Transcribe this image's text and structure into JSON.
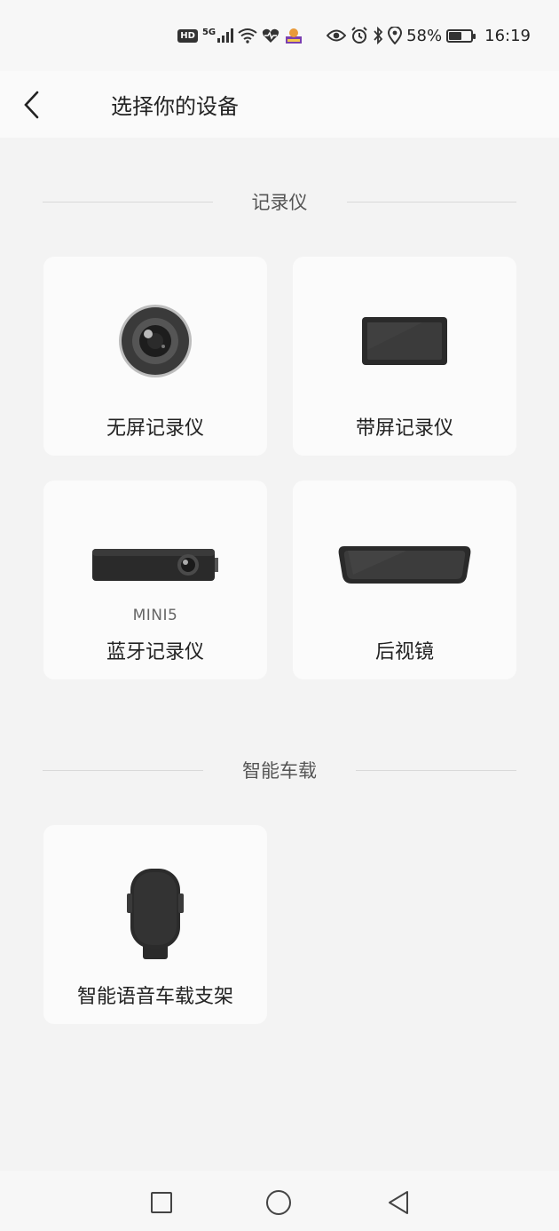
{
  "status_bar": {
    "hd": "HD",
    "network": "5G",
    "battery_percent": "58%",
    "battery_level": 0.58,
    "time": "16:19",
    "icons": [
      "hd-icon",
      "signal-5g-icon",
      "wifi-icon",
      "health-heart-icon",
      "app-notification-icon",
      "eye-icon",
      "alarm-icon",
      "bluetooth-icon",
      "location-icon",
      "battery-icon"
    ]
  },
  "header": {
    "back_icon": "chevron-left-icon",
    "title": "选择你的设备"
  },
  "sections": [
    {
      "title": "记录仪",
      "items": [
        {
          "label": "无屏记录仪",
          "icon": "camera-lens-icon"
        },
        {
          "label": "带屏记录仪",
          "icon": "screen-recorder-icon"
        },
        {
          "label": "蓝牙记录仪",
          "sublabel": "MINI5",
          "icon": "bluetooth-recorder-icon"
        },
        {
          "label": "后视镜",
          "icon": "rearview-mirror-icon"
        }
      ]
    },
    {
      "title": "智能车载",
      "items": [
        {
          "label": "智能语音车载支架",
          "icon": "phone-mount-icon"
        }
      ]
    }
  ],
  "nav_bar": {
    "icons": [
      "recent-apps-icon",
      "home-icon",
      "back-triangle-icon"
    ]
  },
  "colors": {
    "background": "#f3f3f3",
    "card": "#fbfbfb",
    "divider": "#d9d9d9",
    "device": "#2b2b2b"
  }
}
